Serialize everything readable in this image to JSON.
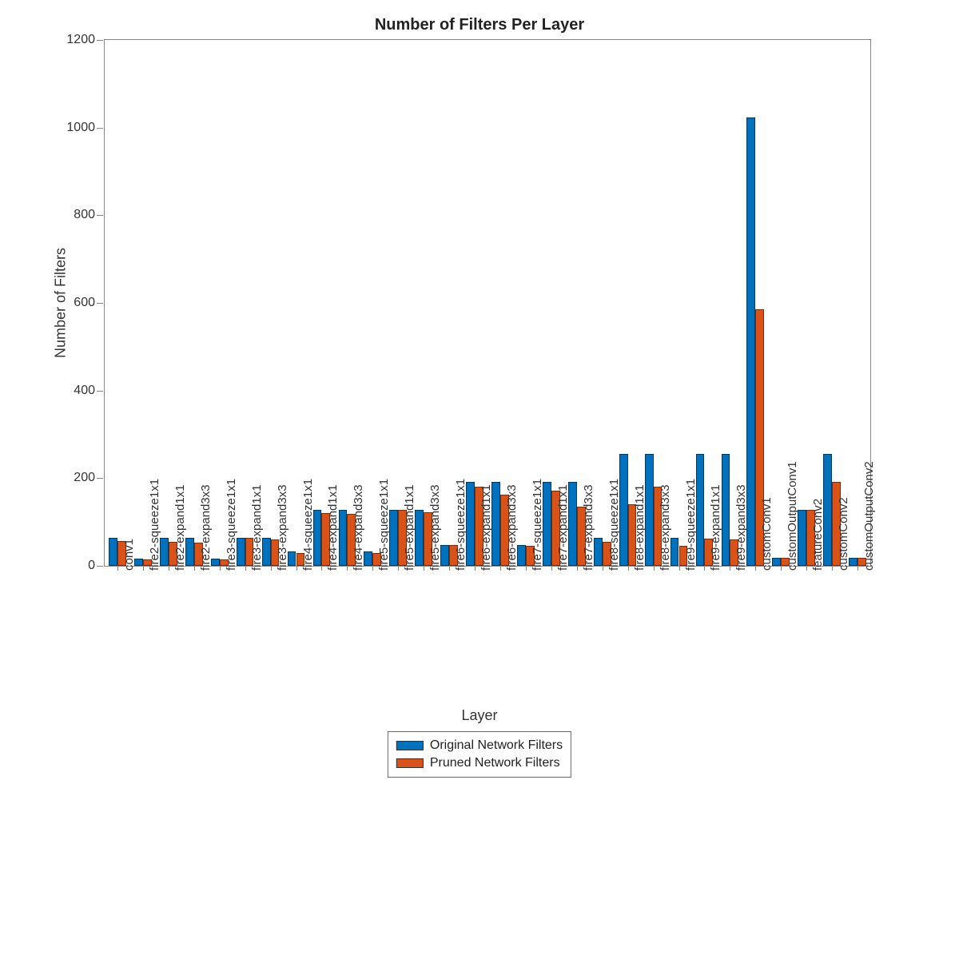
{
  "chart_data": {
    "type": "bar",
    "title": "Number of Filters Per Layer",
    "xlabel": "Layer",
    "ylabel": "Number of Filters",
    "ylim": [
      0,
      1200
    ],
    "yticks": [
      0,
      200,
      400,
      600,
      800,
      1000,
      1200
    ],
    "categories": [
      "conv1",
      "fire2-squeeze1x1",
      "fire2-expand1x1",
      "fire2-expand3x3",
      "fire3-squeeze1x1",
      "fire3-expand1x1",
      "fire3-expand3x3",
      "fire4-squeeze1x1",
      "fire4-expand1x1",
      "fire4-expand3x3",
      "fire5-squeeze1x1",
      "fire5-expand1x1",
      "fire5-expand3x3",
      "fire6-squeeze1x1",
      "fire6-expand1x1",
      "fire6-expand3x3",
      "fire7-squeeze1x1",
      "fire7-expand1x1",
      "fire7-expand3x3",
      "fire8-squeeze1x1",
      "fire8-expand1x1",
      "fire8-expand3x3",
      "fire9-squeeze1x1",
      "fire9-expand1x1",
      "fire9-expand3x3",
      "customConv1",
      "customOutputConv1",
      "featureConv2",
      "customConv2",
      "customOutputConv2"
    ],
    "series": [
      {
        "name": "Original Network Filters",
        "color": "#0072BD",
        "values": [
          64,
          16,
          64,
          64,
          16,
          64,
          64,
          32,
          128,
          128,
          32,
          128,
          128,
          48,
          192,
          192,
          48,
          192,
          192,
          64,
          256,
          256,
          64,
          256,
          256,
          1024,
          18,
          128,
          256,
          18
        ]
      },
      {
        "name": "Pruned Network Filters",
        "color": "#D95319",
        "values": [
          56,
          14,
          55,
          53,
          14,
          63,
          61,
          30,
          120,
          118,
          30,
          128,
          122,
          47,
          180,
          162,
          46,
          172,
          135,
          55,
          140,
          180,
          45,
          62,
          60,
          585,
          18,
          128,
          192,
          18
        ]
      }
    ],
    "legend_position": "bottom-center"
  }
}
